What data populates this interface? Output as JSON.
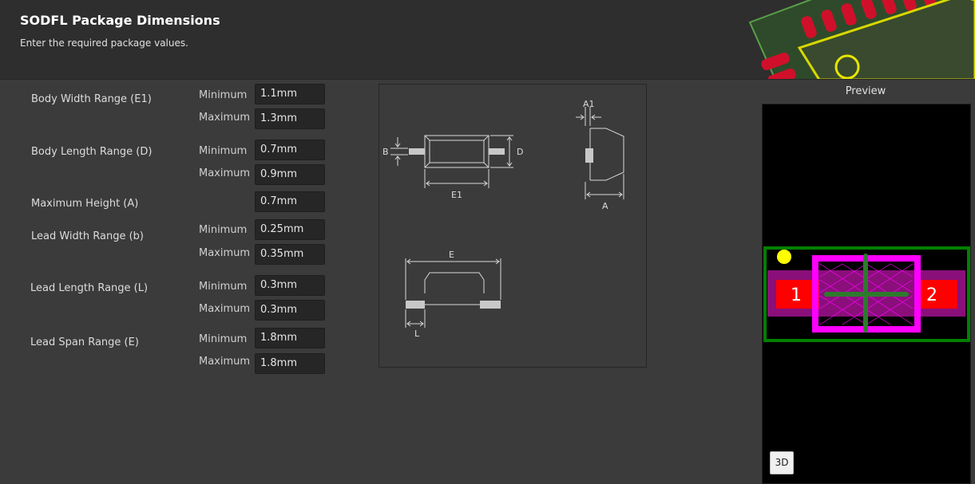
{
  "header": {
    "title": "SODFL Package Dimensions",
    "subtitle": "Enter the required package values."
  },
  "form": {
    "body_width": {
      "label": "Body Width Range (E1)",
      "min_label": "Minimum",
      "max_label": "Maximum",
      "min": "1.1mm",
      "max": "1.3mm"
    },
    "body_length": {
      "label": "Body Length Range (D)",
      "min_label": "Minimum",
      "max_label": "Maximum",
      "min": "0.7mm",
      "max": "0.9mm"
    },
    "max_height": {
      "label": "Maximum Height (A)",
      "value": "0.7mm"
    },
    "lead_width": {
      "label": "Lead Width Range (b)",
      "min_label": "Minimum",
      "max_label": "Maximum",
      "min": "0.25mm",
      "max": "0.35mm"
    },
    "lead_length": {
      "label": "Lead Length Range (L)",
      "min_label": "Minimum",
      "max_label": "Maximum",
      "min": "0.3mm",
      "max": "0.3mm"
    },
    "lead_span": {
      "label": "Lead Span Range (E)",
      "min_label": "Minimum",
      "max_label": "Maximum",
      "min": "1.8mm",
      "max": "1.8mm"
    }
  },
  "diagram": {
    "labels": {
      "B": "B",
      "D": "D",
      "E1": "E1",
      "A1": "A1",
      "A": "A",
      "E": "E",
      "L": "L"
    }
  },
  "preview": {
    "label": "Preview",
    "pad1": "1",
    "pad2": "2",
    "button_3d": "3D"
  },
  "colors": {
    "header_bg": "#2e2e2e",
    "panel_bg": "#3b3b3b",
    "field_bg": "#262626",
    "pad": "#ff0000",
    "courtyard": "#008000",
    "body_outline": "#ff00ff",
    "pin1_dot": "#ffff00"
  }
}
